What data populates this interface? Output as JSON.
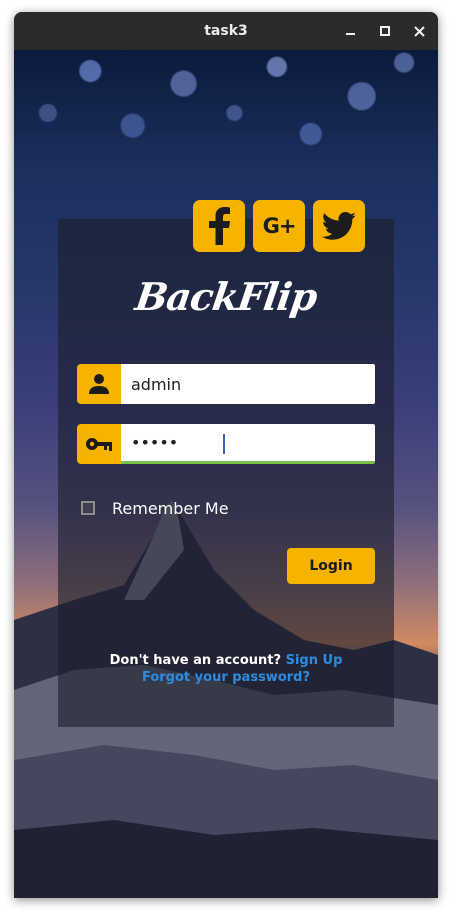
{
  "window": {
    "title": "task3"
  },
  "brand": {
    "logo_text": "BackFlip"
  },
  "social": {
    "facebook_icon": "facebook-icon",
    "google_plus_text": "G+",
    "twitter_icon": "twitter-icon"
  },
  "form": {
    "username_value": "admin",
    "password_value": "•••••",
    "remember_label": "Remember Me",
    "remember_checked": false,
    "login_label": "Login"
  },
  "footer": {
    "no_account_text": "Don't have an account?",
    "signup_link": "Sign Up",
    "forgot_link": "Forgot your password?"
  },
  "colors": {
    "accent": "#f6b400",
    "link": "#2e8ce0",
    "password_focus_underline": "#7bc24a",
    "titlebar": "#2b2b2b"
  }
}
